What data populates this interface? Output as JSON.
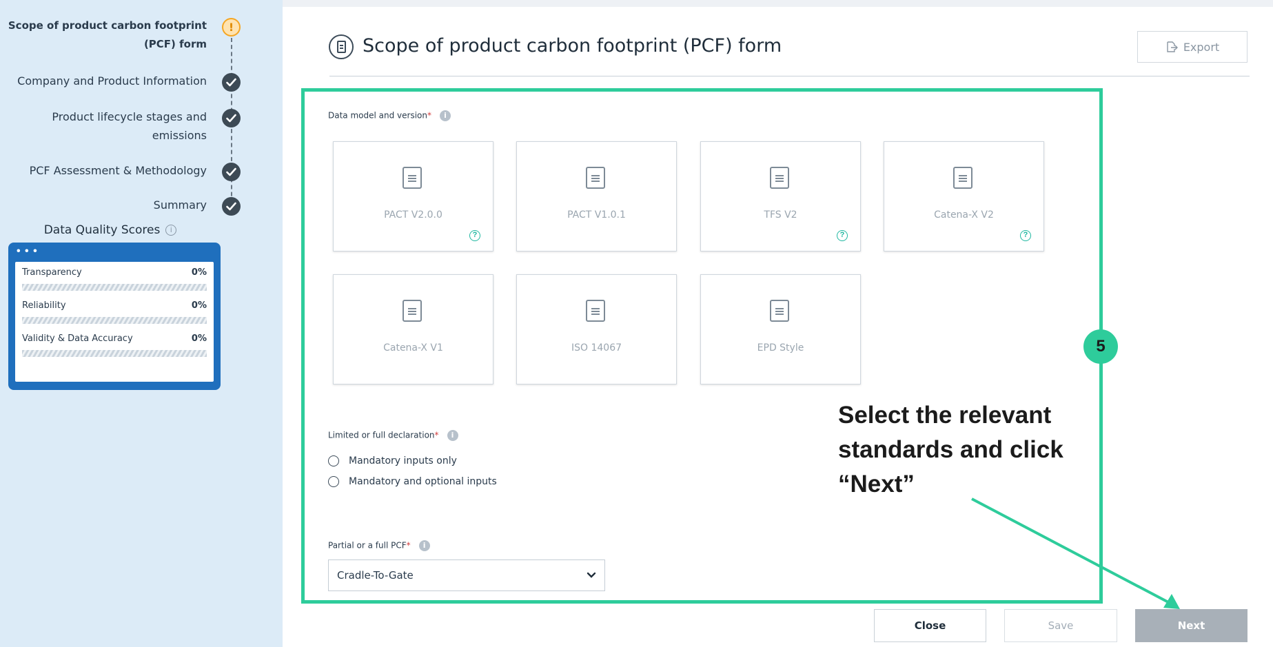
{
  "sidebar": {
    "steps": [
      {
        "label_line1": "Scope of product carbon footprint",
        "label_line2": "(PCF) form",
        "status": "warning"
      },
      {
        "label_line1": "Company and Product Information",
        "label_line2": "",
        "status": "done"
      },
      {
        "label_line1": "Product lifecycle stages and",
        "label_line2": "emissions",
        "status": "done"
      },
      {
        "label_line1": "PCF Assessment & Methodology",
        "label_line2": "",
        "status": "done"
      },
      {
        "label_line1": "Summary",
        "label_line2": "",
        "status": "done"
      }
    ],
    "data_quality": {
      "title": "Data Quality Scores",
      "dots": "• • •",
      "rows": [
        {
          "label": "Transparency",
          "value": "0%"
        },
        {
          "label": "Reliability",
          "value": "0%"
        },
        {
          "label": "Validity & Data Accuracy",
          "value": "0%"
        }
      ]
    }
  },
  "header": {
    "title": "Scope of product carbon footprint (PCF) form",
    "export_label": "Export"
  },
  "form": {
    "data_model_label": "Data model and version",
    "required_mark": "*",
    "cards": [
      {
        "label": "PACT V2.0.0",
        "help": true
      },
      {
        "label": "PACT V1.0.1",
        "help": false
      },
      {
        "label": "TFS V2",
        "help": true
      },
      {
        "label": "Catena-X V2",
        "help": true
      },
      {
        "label": "Catena-X V1",
        "help": false
      },
      {
        "label": "ISO 14067",
        "help": false
      },
      {
        "label": "EPD Style",
        "help": false
      }
    ],
    "declaration_label": "Limited or full declaration",
    "declaration_options": [
      "Mandatory inputs only",
      "Mandatory and optional inputs"
    ],
    "pcf_label": "Partial or a full PCF",
    "pcf_value": "Cradle-To-Gate"
  },
  "annotation": {
    "badge": "5",
    "line1": "Select the relevant",
    "line2": "standards and click",
    "line3": "“Next”",
    "color": "#2ecc9b"
  },
  "footer": {
    "close_label": "Close",
    "save_label": "Save",
    "next_label": "Next"
  }
}
